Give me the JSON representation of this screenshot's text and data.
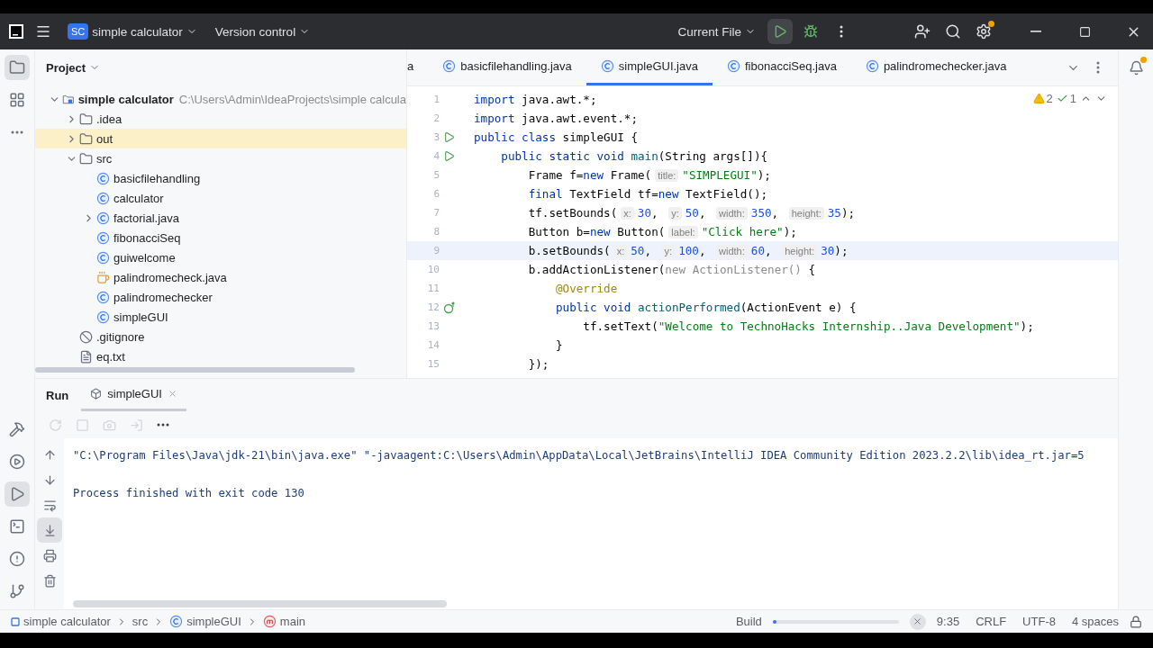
{
  "title_bar": {
    "project_badge": "SC",
    "project": "simple calculator",
    "vcs": "Version control",
    "run_config": "Current File",
    "settings_badge": true
  },
  "left_tools_top": [
    {
      "kind": "folder",
      "selected": true
    },
    {
      "kind": "structure",
      "selected": false
    },
    {
      "kind": "more",
      "selected": false
    }
  ],
  "left_tools_bottom": [
    {
      "kind": "build",
      "selected": false
    },
    {
      "kind": "services",
      "selected": false
    },
    {
      "kind": "run",
      "selected": true
    },
    {
      "kind": "terminal",
      "selected": false
    },
    {
      "kind": "problems",
      "selected": false
    },
    {
      "kind": "git",
      "selected": false
    }
  ],
  "project_panel": {
    "title": "Project",
    "tree": [
      {
        "label": "simple calculator",
        "path": "C:\\Users\\Admin\\IdeaProjects\\simple calcula",
        "kind": "module",
        "expanded": true,
        "children": [
          {
            "label": ".idea",
            "kind": "folder",
            "expanded": false,
            "highlighted": false
          },
          {
            "label": "out",
            "kind": "folder",
            "expanded": false,
            "highlighted": true
          },
          {
            "label": "src",
            "kind": "folder",
            "expanded": true,
            "highlighted": false,
            "children": [
              {
                "label": "basicfilehandling",
                "kind": "class"
              },
              {
                "label": "calculator",
                "kind": "class"
              },
              {
                "label": "factorial.java",
                "kind": "class",
                "expanded": false
              },
              {
                "label": "fibonacciSeq",
                "kind": "class"
              },
              {
                "label": "guiwelcome",
                "kind": "class"
              },
              {
                "label": "palindromecheck.java",
                "kind": "java"
              },
              {
                "label": "palindromechecker",
                "kind": "class"
              },
              {
                "label": "simpleGUI",
                "kind": "class"
              }
            ]
          },
          {
            "label": ".gitignore",
            "kind": "ignore",
            "highlighted": false
          },
          {
            "label": "eq.txt",
            "kind": "text",
            "highlighted": false
          }
        ]
      }
    ]
  },
  "editor_tabs": [
    {
      "label": "a",
      "kind": "clipped",
      "selected": false
    },
    {
      "label": "basicfilehandling.java",
      "kind": "class",
      "selected": false
    },
    {
      "label": "simpleGUI.java",
      "kind": "class",
      "selected": true
    },
    {
      "label": "fibonacciSeq.java",
      "kind": "class",
      "selected": false
    },
    {
      "label": "palindromechecker.java",
      "kind": "class",
      "selected": false
    }
  ],
  "inspections": {
    "warnings": "2",
    "typos": "1"
  },
  "code": [
    {
      "number": "1",
      "current": false,
      "tokens": [
        {
          "kind": "kw",
          "text": "import"
        },
        {
          "kind": "id",
          "text": " java.awt.*;"
        }
      ]
    },
    {
      "number": "2",
      "current": false,
      "tokens": [
        {
          "kind": "kw",
          "text": "import"
        },
        {
          "kind": "id",
          "text": " java.awt.event.*;"
        }
      ]
    },
    {
      "number": "3",
      "current": false,
      "gutter": {
        "kind": "run"
      },
      "tokens": [
        {
          "kind": "kw",
          "text": "public class"
        },
        {
          "kind": "id",
          "text": " simpleGUI {"
        }
      ]
    },
    {
      "number": "4",
      "current": false,
      "gutter": {
        "kind": "run"
      },
      "tokens": [
        {
          "kind": "kw",
          "text": "    public static void "
        },
        {
          "kind": "fn",
          "text": "main"
        },
        {
          "kind": "id",
          "text": "(String args[]){"
        }
      ]
    },
    {
      "number": "5",
      "current": false,
      "tokens": [
        {
          "kind": "id",
          "text": "        Frame f="
        },
        {
          "kind": "kw",
          "text": "new"
        },
        {
          "kind": "id",
          "text": " Frame("
        },
        {
          "kind": "hint",
          "text": "title:"
        },
        {
          "kind": "str",
          "text": "\"SIMPLEGUI\""
        },
        {
          "kind": "id",
          "text": ");"
        }
      ]
    },
    {
      "number": "6",
      "current": false,
      "tokens": [
        {
          "kind": "kw",
          "text": "        final"
        },
        {
          "kind": "id",
          "text": " TextField tf="
        },
        {
          "kind": "kw",
          "text": "new"
        },
        {
          "kind": "id",
          "text": " TextField();"
        }
      ]
    },
    {
      "number": "7",
      "current": false,
      "tokens": [
        {
          "kind": "id",
          "text": "        tf.setBounds("
        },
        {
          "kind": "hint",
          "text": "x:"
        },
        {
          "kind": "num",
          "text": "30"
        },
        {
          "kind": "id",
          "text": ", "
        },
        {
          "kind": "hint",
          "text": "y:"
        },
        {
          "kind": "num",
          "text": "50"
        },
        {
          "kind": "id",
          "text": ", "
        },
        {
          "kind": "hint",
          "text": "width:"
        },
        {
          "kind": "num",
          "text": "350"
        },
        {
          "kind": "id",
          "text": ", "
        },
        {
          "kind": "hint",
          "text": "height:"
        },
        {
          "kind": "num",
          "text": "35"
        },
        {
          "kind": "id",
          "text": ");"
        }
      ]
    },
    {
      "number": "8",
      "current": false,
      "tokens": [
        {
          "kind": "id",
          "text": "        Button b="
        },
        {
          "kind": "kw",
          "text": "new"
        },
        {
          "kind": "id",
          "text": " Button("
        },
        {
          "kind": "hint",
          "text": "label:"
        },
        {
          "kind": "str",
          "text": "\"Click here\""
        },
        {
          "kind": "id",
          "text": ");"
        }
      ]
    },
    {
      "number": "9",
      "current": true,
      "tokens": [
        {
          "kind": "id",
          "text": "        b.setBounds("
        },
        {
          "kind": "hint",
          "text": "x:"
        },
        {
          "kind": "num",
          "text": "50"
        },
        {
          "kind": "id",
          "text": ", "
        },
        {
          "kind": "hint",
          "text": "y:"
        },
        {
          "kind": "num",
          "text": "100"
        },
        {
          "kind": "id",
          "text": ", "
        },
        {
          "kind": "hint",
          "text": "width:"
        },
        {
          "kind": "num",
          "text": "60"
        },
        {
          "kind": "id",
          "text": ", "
        },
        {
          "kind": "hint",
          "text": "height:"
        },
        {
          "kind": "num",
          "text": "30"
        },
        {
          "kind": "id",
          "text": ");"
        }
      ]
    },
    {
      "number": "10",
      "current": false,
      "tokens": [
        {
          "kind": "id",
          "text": "        b.addActionListener("
        },
        {
          "kind": "dim",
          "text": "new ActionListener()"
        },
        {
          "kind": "id",
          "text": " {"
        }
      ]
    },
    {
      "number": "11",
      "current": false,
      "tokens": [
        {
          "kind": "ann",
          "text": "            @Override"
        }
      ]
    },
    {
      "number": "12",
      "current": false,
      "gutter": {
        "kind": "override"
      },
      "tokens": [
        {
          "kind": "kw",
          "text": "            public void "
        },
        {
          "kind": "fn",
          "text": "actionPerformed"
        },
        {
          "kind": "id",
          "text": "(ActionEvent e) {"
        }
      ]
    },
    {
      "number": "13",
      "current": false,
      "tokens": [
        {
          "kind": "id",
          "text": "                tf.setText("
        },
        {
          "kind": "str",
          "text": "\"Welcome to TechnoHacks Internship..Java Development\""
        },
        {
          "kind": "id",
          "text": ");"
        }
      ]
    },
    {
      "number": "14",
      "current": false,
      "tokens": [
        {
          "kind": "id",
          "text": "            }"
        }
      ]
    },
    {
      "number": "15",
      "current": false,
      "tokens": [
        {
          "kind": "id",
          "text": "        });"
        }
      ]
    }
  ],
  "run_panel": {
    "title": "Run",
    "tab": "simpleGUI",
    "toolbar": [
      {
        "kind": "rerun",
        "disabled": true
      },
      {
        "kind": "stop",
        "disabled": true
      },
      {
        "kind": "camera",
        "disabled": true
      },
      {
        "kind": "exit",
        "disabled": true
      },
      {
        "kind": "more",
        "disabled": false
      }
    ],
    "side_tools": [
      {
        "kind": "up",
        "selected": false
      },
      {
        "kind": "down",
        "selected": false
      },
      {
        "kind": "wrap",
        "selected": false
      },
      {
        "kind": "scroll-end",
        "selected": true
      },
      {
        "kind": "print",
        "selected": false
      },
      {
        "kind": "trash",
        "selected": false
      }
    ],
    "console": [
      "\"C:\\Program Files\\Java\\jdk-21\\bin\\java.exe\" \"-javaagent:C:\\Users\\Admin\\AppData\\Local\\JetBrains\\IntelliJ IDEA Community Edition 2023.2.2\\lib\\idea_rt.jar=5",
      "Process finished with exit code 130"
    ]
  },
  "status_bar": {
    "breadcrumbs": [
      {
        "label": "simple calculator",
        "kind": "module"
      },
      {
        "label": "src",
        "kind": "none"
      },
      {
        "label": "simpleGUI",
        "kind": "class"
      },
      {
        "label": "main",
        "kind": "method"
      }
    ],
    "build": {
      "label": "Build",
      "level": 0.02
    },
    "position": "9:35",
    "line_ending": "CRLF",
    "encoding": "UTF-8",
    "indent": "4 spaces"
  }
}
